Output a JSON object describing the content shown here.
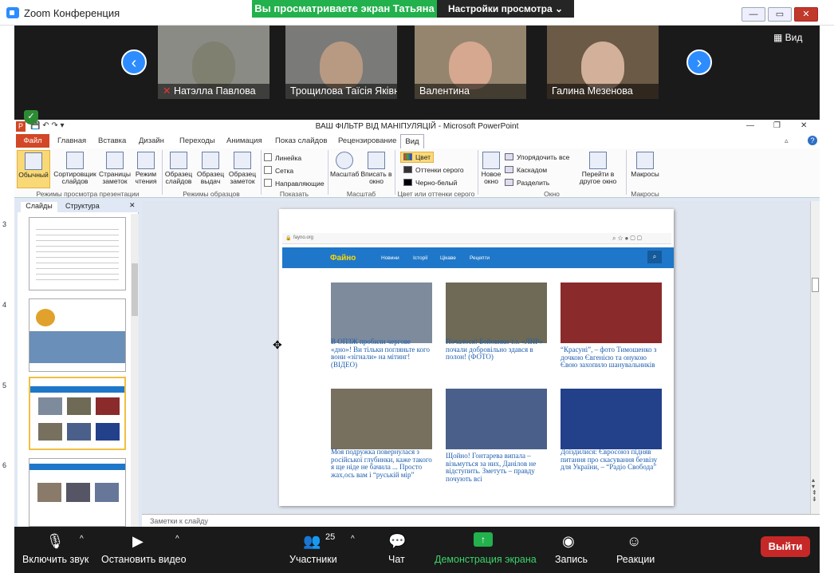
{
  "zoom": {
    "window_title": "Zoom Конференция",
    "viewing_banner": "Вы просматриваете экран Татьяна",
    "view_settings": "Настройки просмотра ⌄",
    "view_label": "Вид",
    "participants": [
      {
        "name": "Натэлла Павлова"
      },
      {
        "name": "Трощилова Таїсія Яківна"
      },
      {
        "name": "Валентина"
      },
      {
        "name": "Галина Мезенова"
      }
    ],
    "toolbar": {
      "mute": "Включить звук",
      "video": "Остановить видео",
      "participants": "Участники",
      "participants_count": "25",
      "chat": "Чат",
      "share": "Демонстрация экрана",
      "record": "Запись",
      "reactions": "Реакции",
      "leave": "Выйти"
    }
  },
  "powerpoint": {
    "title": "ВАШ ФІЛЬТР ВІД МАНІПУЛЯЦІЙ  -  Microsoft PowerPoint",
    "tabs": [
      "Файл",
      "Главная",
      "Вставка",
      "Дизайн",
      "Переходы",
      "Анимация",
      "Показ слайдов",
      "Рецензирование",
      "Вид"
    ],
    "ribbon": {
      "normal": "Обычный",
      "sorter": "Сортировщик слайдов",
      "notes_page": "Страницы заметок",
      "reading": "Режим чтения",
      "slide_master": "Образец слайдов",
      "handout_master": "Образец выдач",
      "notes_master": "Образец заметок",
      "ruler": "Линейка",
      "grid": "Сетка",
      "guides": "Направляющие",
      "zoom": "Масштаб",
      "fit": "Вписать в окно",
      "color": "Цвет",
      "grayscale": "Оттенки серого",
      "bw": "Черно-белый",
      "new_window": "Новое окно",
      "arrange": "Упорядочить все",
      "cascade": "Каскадом",
      "split": "Разделить",
      "switch": "Перейти в другое окно",
      "macros": "Макросы",
      "groups": {
        "views": "Режимы просмотра презентации",
        "masters": "Режимы образцов",
        "show": "Показать",
        "zoom": "Масштаб",
        "color": "Цвет или оттенки серого",
        "window": "Окно",
        "macros": "Макросы"
      }
    },
    "pane_tabs": {
      "slides": "Слайды",
      "outline": "Структура"
    },
    "slide_numbers": [
      "3",
      "4",
      "5",
      "6"
    ],
    "notes_placeholder": "Заметки к слайду"
  },
  "website": {
    "url": "fayno.org",
    "logo": "Файно",
    "nav": [
      "Новини",
      "Історії",
      "Цікаве",
      "Рецепти"
    ],
    "articles": [
      {
        "text": "В ОПЗЖ пробили чергове «дно»! Ви тільки погляньте кого вони «зігнали» на мітинг! (ВІДЕО)",
        "color": "#7d8b9c"
      },
      {
        "text": "Почалося! Бойовики т.з. «ЛНР» почали добровільно здався в полон! (ФОТО)",
        "color": "#6e6a55"
      },
      {
        "text": "“Красуні”, – фото Тимошенко з дочкою Євгенією та онукою Євою захопило шанувальників",
        "color": "#8b2a2a"
      },
      {
        "text": "Моя подружка повернулася з російської глубинки, каже такого я ще ніде не бачила ... Просто жах,ось вам і “руській мір”",
        "color": "#77705f"
      },
      {
        "text": "Щойно! Гонтарева випала – візьмуться за них, Данілов не відступить. Зметуть – правду почують всі",
        "color": "#4a5f8a"
      },
      {
        "text": "Доїздилися: Євросоюз підняв питання про скасування безвізу для України, – “Радіо Свобода”",
        "color": "#23408a"
      }
    ]
  }
}
